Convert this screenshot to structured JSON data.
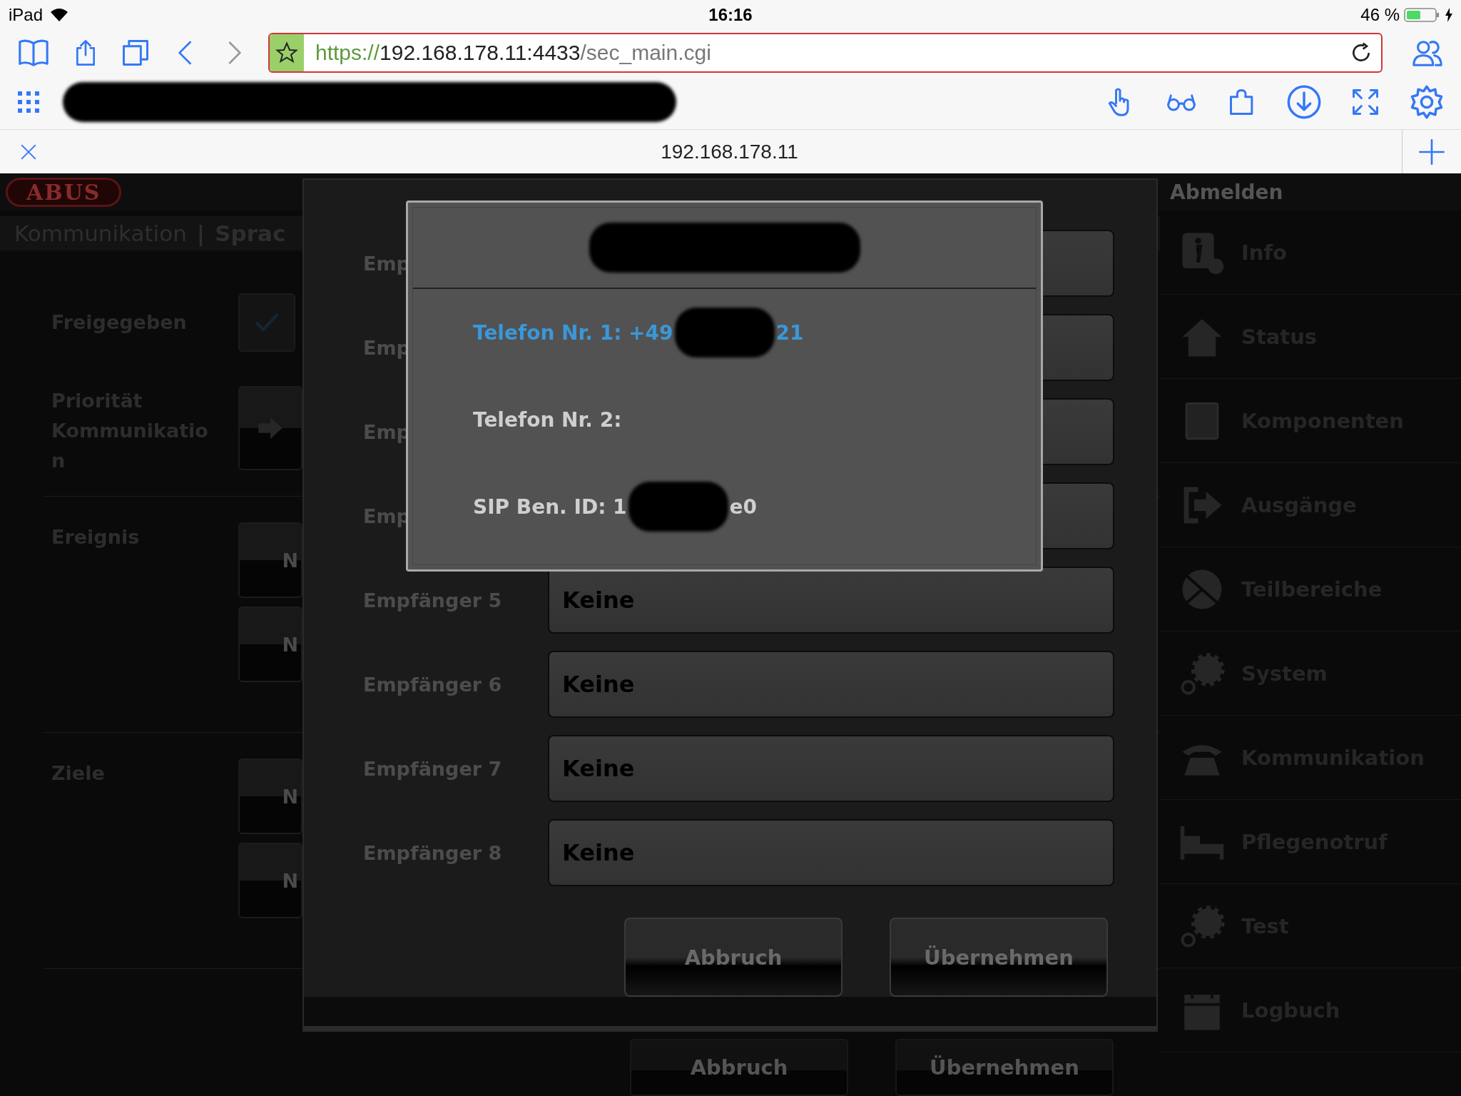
{
  "status_bar": {
    "device": "iPad",
    "time": "16:16",
    "battery": "46 %"
  },
  "browser": {
    "url_scheme": "https://",
    "url_host": "192.168.178.11:4433",
    "url_path": "/sec_main.cgi",
    "tab_title": "192.168.178.11"
  },
  "header": {
    "logo": "ABUS",
    "logout": "Abmelden"
  },
  "breadcrumb": {
    "section": "Kommunikation",
    "separator": "|",
    "page": "Sprac"
  },
  "form": [
    {
      "kind": "checkbox",
      "label": "Freigegeben",
      "checked": true
    },
    {
      "kind": "arrow",
      "label": "Priorität Kommunikation"
    },
    {
      "kind": "buttons",
      "label": "Ereignis",
      "buttons": [
        "N",
        "N"
      ]
    },
    {
      "kind": "buttons",
      "label": "Ziele",
      "buttons": [
        "N",
        "N"
      ]
    }
  ],
  "page_buttons": [
    "Abbruch",
    "Übernehmen"
  ],
  "sidebar": [
    {
      "label": "Info"
    },
    {
      "label": "Status"
    },
    {
      "label": "Komponenten"
    },
    {
      "label": "Ausgänge"
    },
    {
      "label": "Teilbereiche"
    },
    {
      "label": "System"
    },
    {
      "label": "Kommunikation"
    },
    {
      "label": "Pflegenotruf"
    },
    {
      "label": "Test"
    },
    {
      "label": "Logbuch"
    }
  ],
  "recipients_dialog": {
    "rows": [
      {
        "label": "Emp"
      },
      {
        "label": "Emp"
      },
      {
        "label": "Emp"
      },
      {
        "label": "Emp"
      },
      {
        "label": "Empfänger 5",
        "value": "Keine"
      },
      {
        "label": "Empfänger 6",
        "value": "Keine"
      },
      {
        "label": "Empfänger 7",
        "value": "Keine"
      },
      {
        "label": "Empfänger 8",
        "value": "Keine"
      }
    ],
    "buttons": [
      "Abbruch",
      "Übernehmen"
    ]
  },
  "popup": {
    "options": [
      {
        "text": "Telefon Nr. 1: +49",
        "tail": "21",
        "selected": true
      },
      {
        "text": "Telefon Nr. 2:",
        "selected": false
      },
      {
        "text": "SIP Ben. ID: 1",
        "tail": "e0",
        "selected": false
      }
    ]
  }
}
